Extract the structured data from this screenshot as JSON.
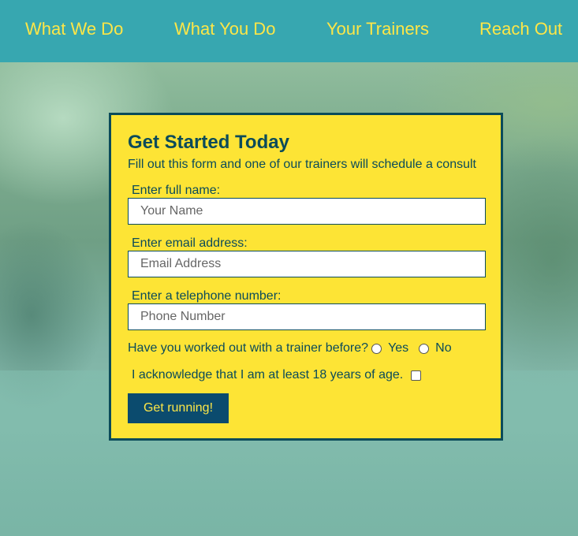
{
  "nav": {
    "items": [
      "What We Do",
      "What You Do",
      "Your Trainers",
      "Reach Out"
    ]
  },
  "form": {
    "title": "Get Started Today",
    "subtitle": "Fill out this form and one of our trainers will schedule a consult",
    "name_label": "Enter full name:",
    "name_placeholder": "Your Name",
    "email_label": "Enter email address:",
    "email_placeholder": "Email Address",
    "phone_label": "Enter a telephone number:",
    "phone_placeholder": "Phone Number",
    "trainer_question": "Have you worked out with a trainer before?",
    "option_yes": "Yes",
    "option_no": "No",
    "age_ack": "I acknowledge that I am at least 18 years of age.",
    "submit_label": "Get running!"
  },
  "colors": {
    "nav_bg": "#37a7b0",
    "nav_text": "#fde647",
    "form_bg": "#fde435",
    "form_text": "#0b4b5a",
    "button_bg": "#0b4b6e"
  }
}
